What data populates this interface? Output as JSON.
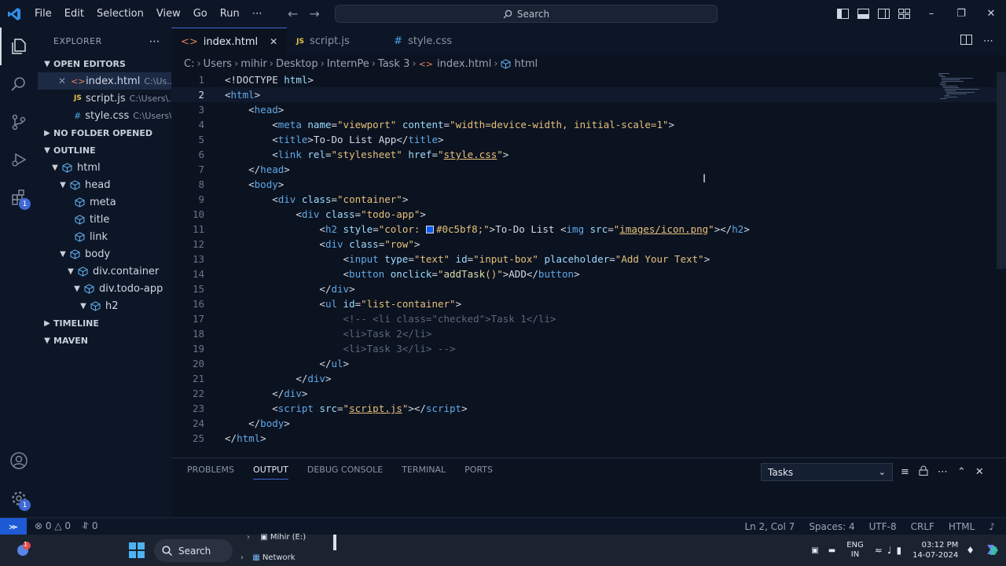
{
  "menu": [
    "File",
    "Edit",
    "Selection",
    "View",
    "Go",
    "Run",
    "⋯"
  ],
  "search": {
    "label": "Search"
  },
  "sidebar": {
    "title": "EXPLORER",
    "open_editors": {
      "label": "OPEN EDITORS",
      "files": [
        {
          "name": "index.html",
          "path": "C:\\Us...",
          "type": "html"
        },
        {
          "name": "script.js",
          "path": "C:\\Users\\...",
          "type": "js"
        },
        {
          "name": "style.css",
          "path": "C:\\Users\\...",
          "type": "css"
        }
      ]
    },
    "no_folder": "NO FOLDER OPENED",
    "outline": {
      "label": "OUTLINE",
      "items": [
        "html",
        "head",
        "meta",
        "title",
        "link",
        "body",
        "div.container",
        "div.todo-app",
        "h2"
      ]
    },
    "timeline": "TIMELINE",
    "maven": "MAVEN"
  },
  "tabs": [
    {
      "label": "index.html",
      "type": "html"
    },
    {
      "label": "script.js",
      "type": "js"
    },
    {
      "label": "style.css",
      "type": "css"
    }
  ],
  "breadcrumb": [
    "C:",
    "Users",
    "mihir",
    "Desktop",
    "InternPe",
    "Task 3",
    "index.html",
    "html"
  ],
  "code_lines": [
    "1",
    "2",
    "3",
    "4",
    "5",
    "6",
    "7",
    "8",
    "9",
    "10",
    "11",
    "12",
    "13",
    "14",
    "15",
    "16",
    "17",
    "18",
    "19",
    "20",
    "21",
    "22",
    "23",
    "24",
    "25"
  ],
  "panel": {
    "tabs": [
      "PROBLEMS",
      "OUTPUT",
      "DEBUG CONSOLE",
      "TERMINAL",
      "PORTS"
    ],
    "select_value": "Tasks"
  },
  "status": {
    "errors": "0",
    "warnings": "0",
    "ports": "0",
    "position": "Ln 2, Col 7",
    "spaces": "Spaces: 4",
    "encoding": "UTF-8",
    "eol": "CRLF",
    "language": "HTML"
  },
  "taskbar": {
    "search": "Search",
    "drive": "Mihir (E:)",
    "network": "Network",
    "lang_top": "ENG",
    "lang_bottom": "IN",
    "time": "03:12 PM",
    "date": "14-07-2024"
  },
  "badges": {
    "extensions": "1",
    "settings": "1",
    "notifications": "1"
  },
  "colors": {
    "accent": "#3f69d6",
    "swatch": "#0c5bf8"
  }
}
